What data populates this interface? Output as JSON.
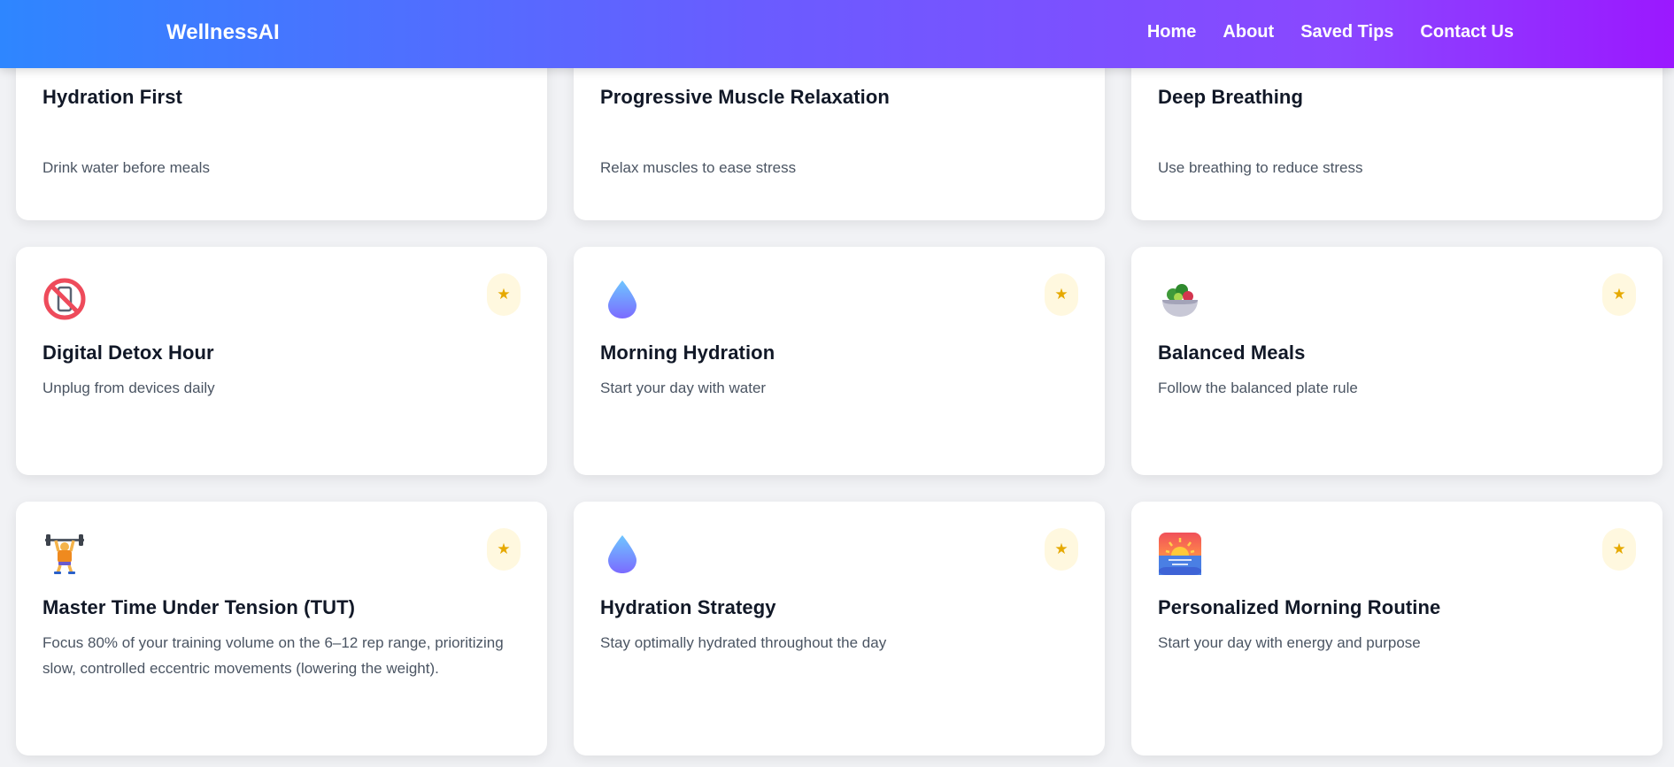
{
  "nav": {
    "brand": "WellnessAI",
    "links": [
      "Home",
      "About",
      "Saved Tips",
      "Contact Us"
    ]
  },
  "colors": {
    "gradient_start": "#2e86ff",
    "gradient_end": "#9b18ff",
    "star": "#e6a900",
    "star_bg": "#fff8df"
  },
  "save_icon": "★",
  "tips": [
    {
      "title": "Hydration First",
      "desc": "Drink water before meals",
      "icon": "none"
    },
    {
      "title": "Progressive Muscle Relaxation",
      "desc": "Relax muscles to ease stress",
      "icon": "none"
    },
    {
      "title": "Deep Breathing",
      "desc": "Use breathing to reduce stress",
      "icon": "none"
    },
    {
      "title": "Digital Detox Hour",
      "desc": "Unplug from devices daily",
      "icon": "no-phone-icon"
    },
    {
      "title": "Morning Hydration",
      "desc": "Start your day with water",
      "icon": "water-drop-icon"
    },
    {
      "title": "Balanced Meals",
      "desc": "Follow the balanced plate rule",
      "icon": "salad-bowl-icon"
    },
    {
      "title": "Master Time Under Tension (TUT)",
      "desc": "Focus 80% of your training volume on the 6–12 rep range, prioritizing slow, controlled eccentric movements (lowering the weight).",
      "icon": "weightlifter-icon"
    },
    {
      "title": "Hydration Strategy",
      "desc": "Stay optimally hydrated throughout the day",
      "icon": "water-drop-icon"
    },
    {
      "title": "Personalized Morning Routine",
      "desc": "Start your day with energy and purpose",
      "icon": "sunrise-icon"
    }
  ]
}
